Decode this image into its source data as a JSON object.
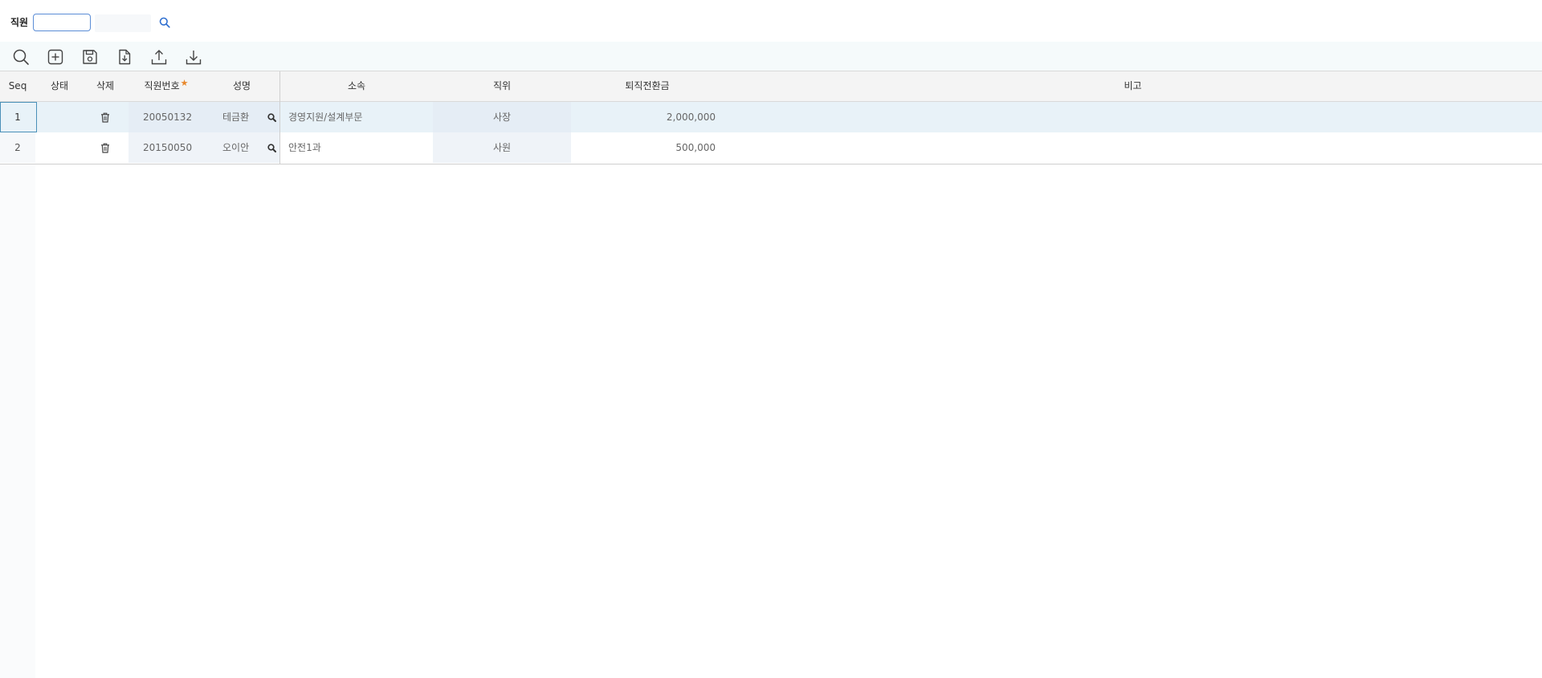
{
  "filter": {
    "label": "직원",
    "employee_input_value": "",
    "employee_name_value": ""
  },
  "toolbar": {
    "buttons": [
      {
        "icon": "search-icon"
      },
      {
        "icon": "add-icon"
      },
      {
        "icon": "save-icon"
      },
      {
        "icon": "file-download-icon"
      },
      {
        "icon": "upload-icon"
      },
      {
        "icon": "download-icon"
      }
    ]
  },
  "grid": {
    "columns": {
      "seq": "Seq",
      "status": "상태",
      "delete": "삭제",
      "emp_no": "직원번호",
      "name": "성명",
      "dept": "소속",
      "position": "직위",
      "retire_amount": "퇴직전환금",
      "remarks": "비고"
    },
    "required_mark": "★",
    "rows": [
      {
        "seq": "1",
        "status": "",
        "emp_no": "20050132",
        "name": "테금환",
        "dept": "경영지원/설계부문",
        "position": "사장",
        "retire_amount": "2,000,000",
        "remarks": ""
      },
      {
        "seq": "2",
        "status": "",
        "emp_no": "20150050",
        "name": "오이안",
        "dept": "안전1과",
        "position": "사원",
        "retire_amount": "500,000",
        "remarks": ""
      }
    ]
  },
  "colors": {
    "accent": "#5b8dd6",
    "required": "#e8872b",
    "selected_row": "#e8f2f8",
    "header_bg": "#f4f4f4"
  }
}
